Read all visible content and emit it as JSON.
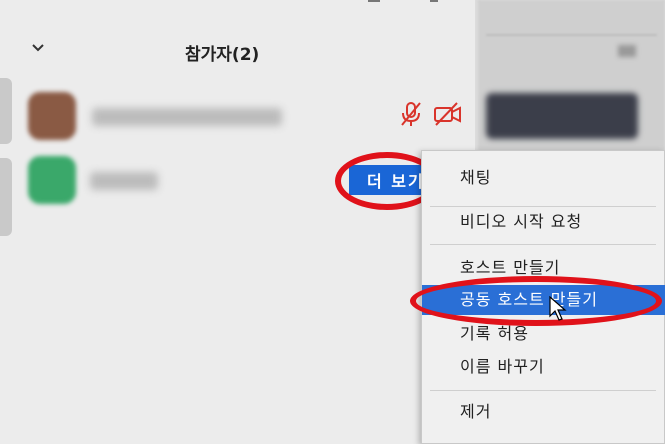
{
  "header": {
    "title": "참가자(2)"
  },
  "participants": [
    {
      "avatar_color": "#8a5a44",
      "muted": true,
      "video_off": true
    },
    {
      "avatar_color": "#3aa86a"
    }
  ],
  "more_button": {
    "label": "더 보기"
  },
  "context_menu": {
    "items": [
      {
        "label": "채팅"
      },
      {
        "label": "비디오 시작 요청"
      },
      {
        "label": "호스트 만들기"
      },
      {
        "label": "공동 호스트 만들기",
        "highlighted": true
      },
      {
        "label": "기록 허용"
      },
      {
        "label": "이름 바꾸기"
      },
      {
        "label": "제거"
      }
    ]
  },
  "colors": {
    "accent_blue": "#1a66d6",
    "annotation_red": "#e0121a",
    "icon_red": "#d9342b"
  }
}
